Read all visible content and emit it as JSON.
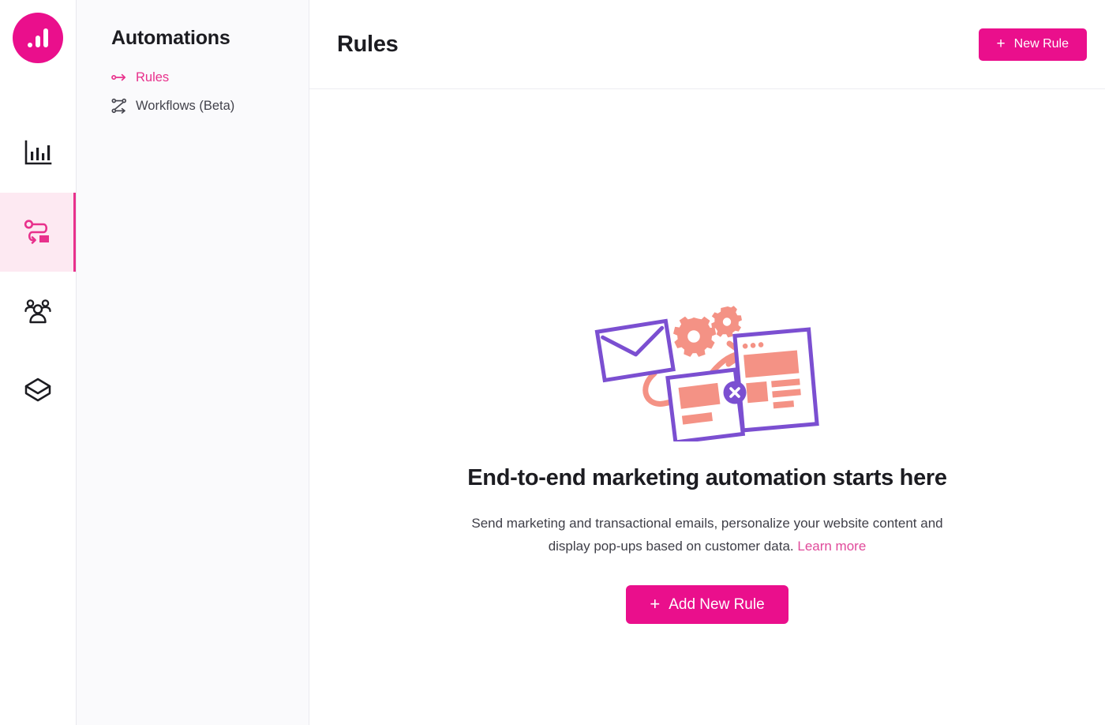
{
  "brand": {
    "logo_icon": "bar-chart-logo-icon",
    "accent_color": "#ea0f8c",
    "accent_soft_color": "#fde9f2",
    "link_color": "#e0499a",
    "illustration_purple": "#7b4fd1",
    "illustration_salmon": "#f49285"
  },
  "rail": {
    "items": [
      {
        "icon": "analytics-bar-chart-icon",
        "name": "analytics",
        "active": false
      },
      {
        "icon": "automations-flow-icon",
        "name": "automations",
        "active": true
      },
      {
        "icon": "audience-people-icon",
        "name": "audience",
        "active": false
      },
      {
        "icon": "products-box-icon",
        "name": "products",
        "active": false
      }
    ]
  },
  "sidebar": {
    "title": "Automations",
    "items": [
      {
        "label": "Rules",
        "icon": "rule-arrow-icon",
        "active": true
      },
      {
        "label": "Workflows (Beta)",
        "icon": "workflow-branch-icon",
        "active": false
      }
    ]
  },
  "header": {
    "title": "Rules",
    "new_rule_label": "New Rule",
    "plus": "+"
  },
  "empty_state": {
    "illustration": "marketing-automation-illustration",
    "title": "End-to-end marketing automation starts here",
    "body_line1": "Send marketing and transactional emails, personalize your website",
    "body_line2": "content and display pop-ups based on customer data.",
    "learn_more_label": "Learn more",
    "cta_label": "Add New Rule",
    "plus": "+"
  }
}
